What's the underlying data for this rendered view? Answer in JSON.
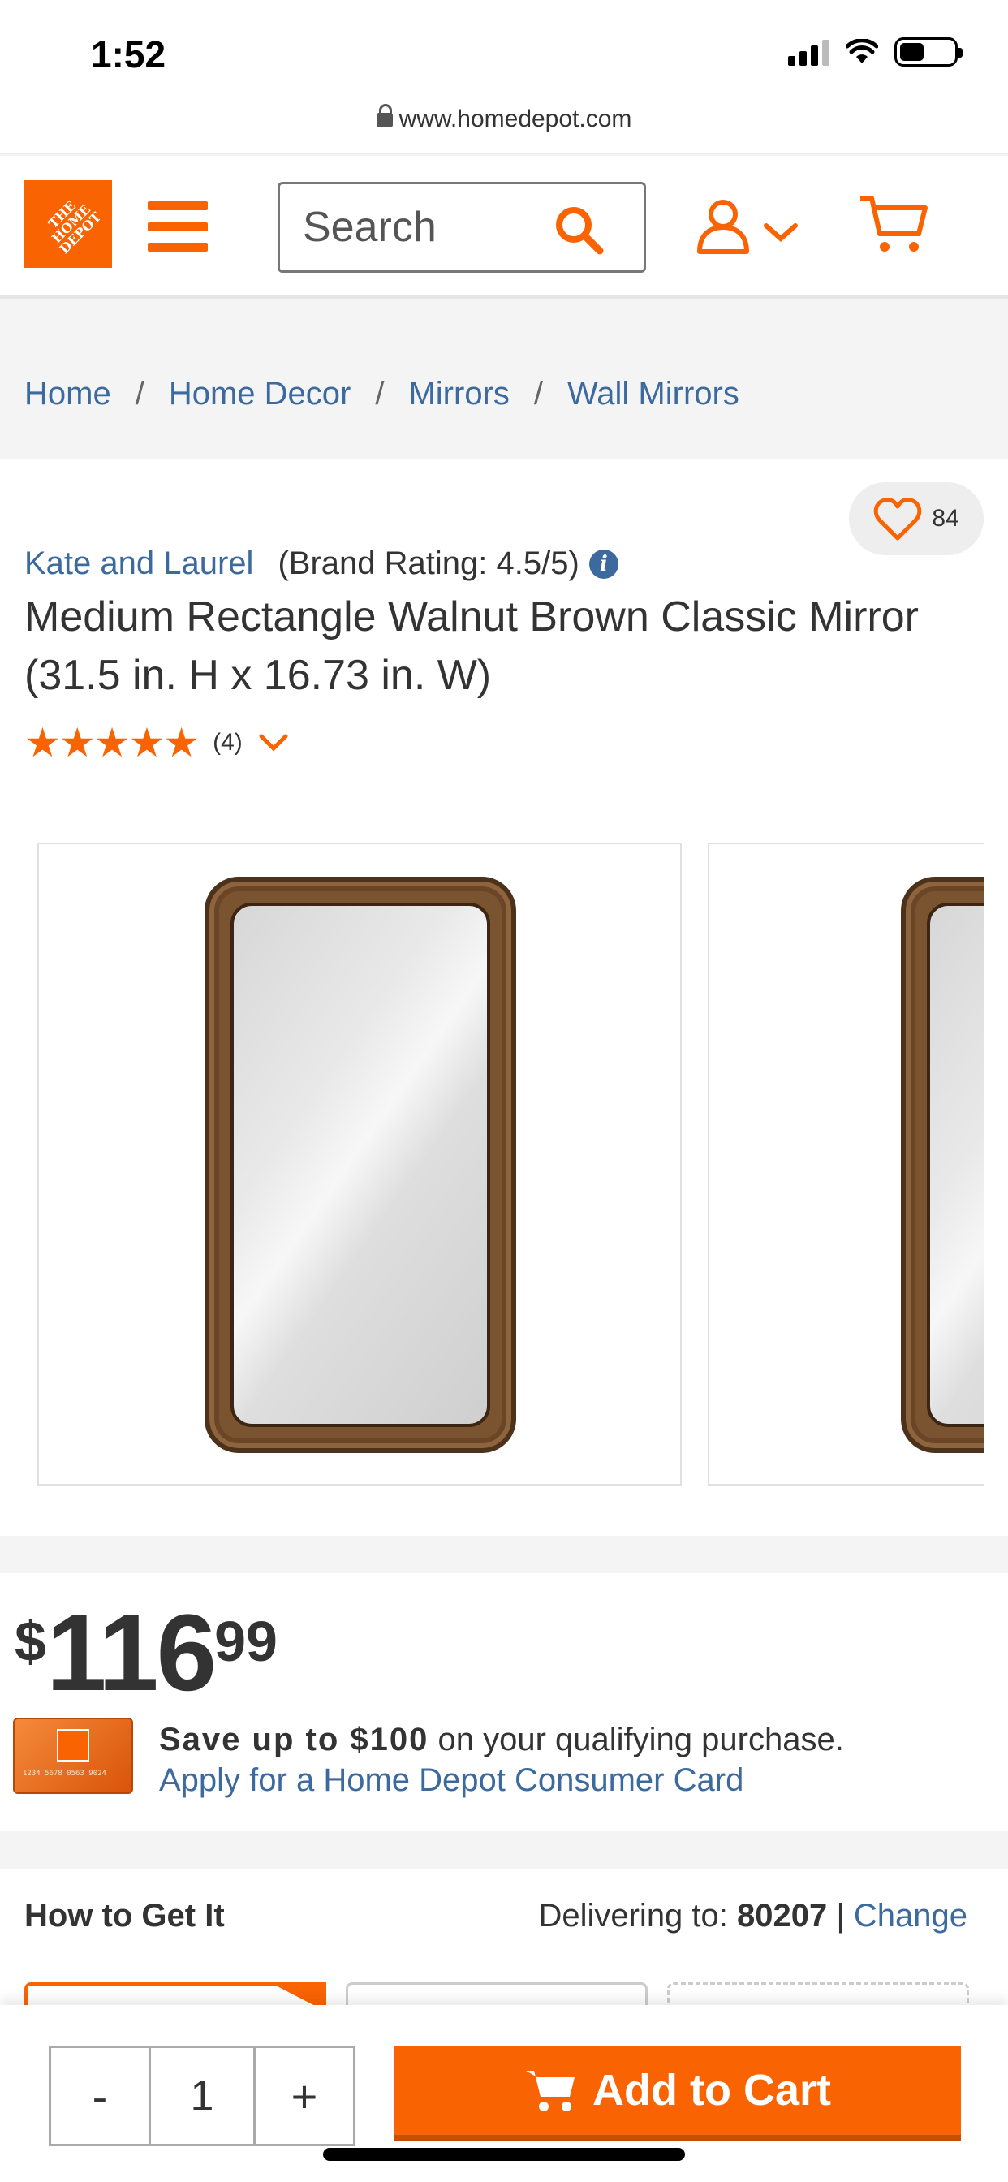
{
  "status_bar": {
    "time": "1:52"
  },
  "browser": {
    "url": "www.homedepot.com"
  },
  "header": {
    "logo_text": "THE HOME DEPOT",
    "search_placeholder": "Search"
  },
  "breadcrumb": [
    "Home",
    "Home Decor",
    "Mirrors",
    "Wall Mirrors"
  ],
  "product": {
    "favorite_count": "84",
    "brand": "Kate and Laurel",
    "brand_rating": "(Brand Rating: 4.5/5)",
    "title": "Medium Rectangle Walnut Brown Classic Mirror (31.5 in. H x 16.73 in. W)",
    "stars": "★★★★★",
    "rating": 5,
    "review_count": "(4)"
  },
  "pricing": {
    "currency": "$",
    "dollars": "116",
    "cents": "99",
    "card_number": "1234 5678 0563 9024",
    "promo_prefix": "Save up to $100",
    "promo_suffix": " on your qualifying purchase.",
    "promo_link": "Apply for a Home Depot Consumer Card"
  },
  "fulfillment": {
    "title": "How to Get It",
    "delivering_label": "Delivering to: ",
    "zip": "80207",
    "separator": " | ",
    "change_label": "Change"
  },
  "cart_bar": {
    "minus": "-",
    "quantity": "1",
    "plus": "+",
    "add_label": "Add to Cart"
  },
  "colors": {
    "brand_orange": "#f96302",
    "link_blue": "#3d6a9e"
  },
  "icons": [
    "lock-icon",
    "menu-icon",
    "search-icon",
    "account-icon",
    "chevron-down-icon",
    "cart-icon",
    "heart-icon",
    "info-icon",
    "star-icon"
  ]
}
